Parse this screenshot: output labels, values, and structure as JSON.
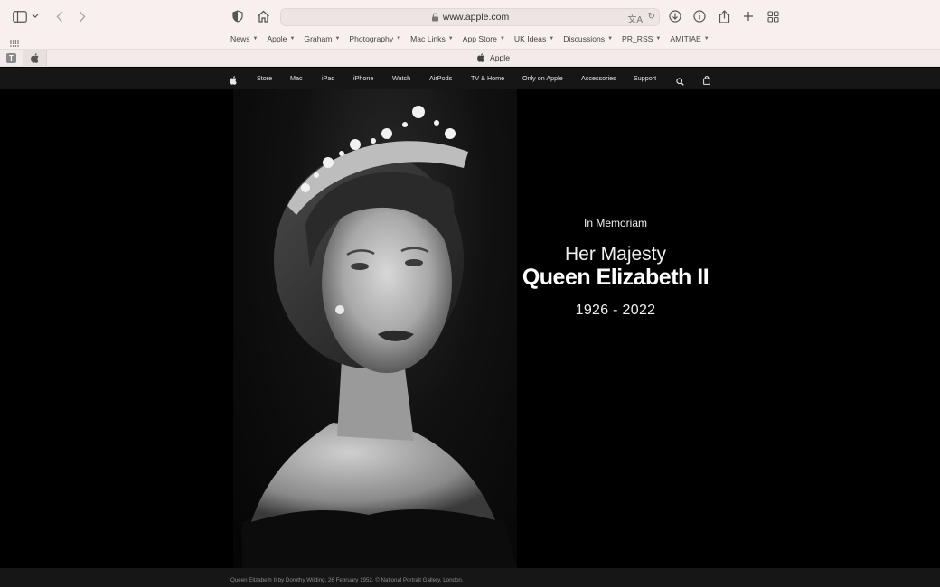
{
  "browser": {
    "address": "www.apple.com",
    "active_tab_title": "Apple",
    "pinned_tab_letter": "T",
    "favorites": [
      {
        "label": "News"
      },
      {
        "label": "Apple"
      },
      {
        "label": "Graham"
      },
      {
        "label": "Photography"
      },
      {
        "label": "Mac Links"
      },
      {
        "label": "App Store"
      },
      {
        "label": "UK Ideas"
      },
      {
        "label": "Discussions"
      },
      {
        "label": "PR_RSS"
      },
      {
        "label": "AMITIAE"
      }
    ]
  },
  "nav": {
    "store": "Store",
    "mac": "Mac",
    "ipad": "iPad",
    "iphone": "iPhone",
    "watch": "Watch",
    "airpods": "AirPods",
    "tv_home": "TV & Home",
    "only_on_apple": "Only on Apple",
    "accessories": "Accessories",
    "support": "Support"
  },
  "hero": {
    "eyebrow": "In Memoriam",
    "title_line1": "Her Majesty",
    "title_line2": "Queen Elizabeth II",
    "years": "1926 - 2022"
  },
  "footer": {
    "caption": "Queen Elizabeth II by Dorothy Wilding, 26 February 1952. © National Portrait Gallery, London."
  }
}
